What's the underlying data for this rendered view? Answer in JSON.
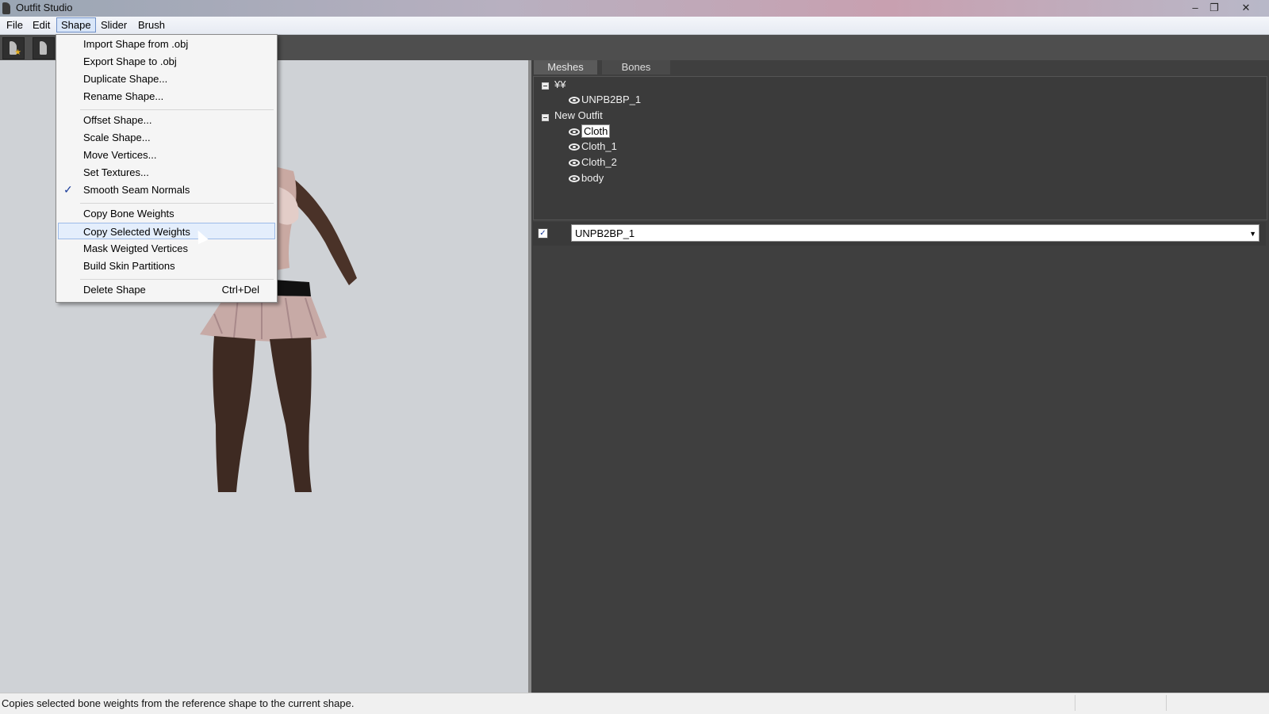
{
  "window": {
    "title": "Outfit Studio",
    "controls": [
      "–",
      "❐",
      "✕"
    ]
  },
  "menubar": {
    "items": [
      "File",
      "Edit",
      "Shape",
      "Slider",
      "Brush"
    ]
  },
  "shape_menu": {
    "items": [
      {
        "label": "Import Shape from .obj"
      },
      {
        "label": "Export Shape to .obj"
      },
      {
        "label": "Duplicate Shape..."
      },
      {
        "label": "Rename Shape..."
      },
      {
        "label": "Offset Shape..."
      },
      {
        "label": "Scale Shape..."
      },
      {
        "label": "Move Vertices..."
      },
      {
        "label": "Set Textures..."
      },
      {
        "label": "Smooth Seam Normals",
        "checked": true
      },
      {
        "label": "Copy Bone Weights"
      },
      {
        "label": "Copy Selected Weights",
        "hovered": true
      },
      {
        "label": "Mask Weigted Vertices"
      },
      {
        "label": "Build Skin Partitions"
      },
      {
        "label": "Delete Shape",
        "shortcut": "Ctrl+Del"
      }
    ],
    "check_mark": "✓"
  },
  "panel": {
    "tabs": [
      "Meshes",
      "Bones"
    ],
    "tree": {
      "groups": [
        {
          "label": "¥¥",
          "children": [
            "UNPB2BP_1"
          ]
        },
        {
          "label": "New Outfit",
          "children": [
            "Cloth",
            "Cloth_1",
            "Cloth_2",
            "body"
          ],
          "selected": "Cloth"
        }
      ]
    },
    "reference": {
      "checkbox_mark": "✓",
      "value": "UNPB2BP_1",
      "arrow": "▼"
    }
  },
  "statusbar": {
    "message": "Copies selected bone weights from the reference shape to the current shape."
  },
  "colors": {
    "accent": "#1a3c9a",
    "panel_bg": "#3f3f3f",
    "viewport_bg": "#cfd2d6",
    "hover": "#e4eefc"
  }
}
